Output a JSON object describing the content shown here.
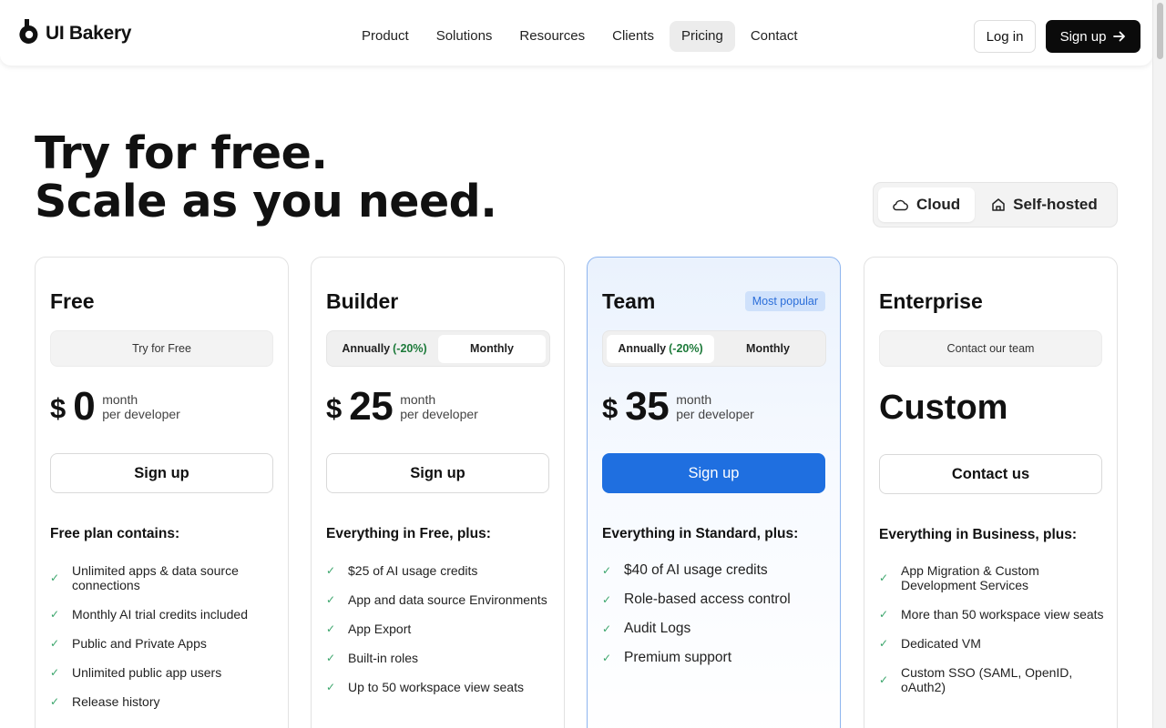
{
  "header": {
    "logo_text": "UI Bakery",
    "nav": [
      {
        "label": "Product",
        "active": false
      },
      {
        "label": "Solutions",
        "active": false
      },
      {
        "label": "Resources",
        "active": false
      },
      {
        "label": "Clients",
        "active": false
      },
      {
        "label": "Pricing",
        "active": true
      },
      {
        "label": "Contact",
        "active": false
      }
    ],
    "login_label": "Log in",
    "signup_label": "Sign up"
  },
  "hero": {
    "title_line1": "Try for free.",
    "title_line2": "Scale as you need."
  },
  "deployment_toggle": {
    "cloud_label": "Cloud",
    "self_hosted_label": "Self-hosted",
    "selected": "Cloud"
  },
  "plans": [
    {
      "name": "Free",
      "bar_label": "Try for Free",
      "currency": "$",
      "price": "0",
      "period": "month",
      "unit": "per developer",
      "cta": "Sign up",
      "contains_title": "Free plan contains:",
      "features": [
        "Unlimited apps & data source connections",
        "Monthly AI trial credits included",
        "Public and Private Apps",
        "Unlimited public app users",
        "Release history"
      ]
    },
    {
      "name": "Builder",
      "billing": {
        "annually": "Annually",
        "discount": "(-20%)",
        "monthly": "Monthly",
        "selected": "Monthly"
      },
      "currency": "$",
      "price": "25",
      "period": "month",
      "unit": "per developer",
      "cta": "Sign up",
      "contains_title": "Everything in Free, plus:",
      "features": [
        "$25 of AI usage credits",
        "App and data source Environments",
        "App Export",
        "Built-in roles",
        "Up to 50 workspace view seats"
      ]
    },
    {
      "name": "Team",
      "badge": "Most popular",
      "billing": {
        "annually": "Annually",
        "discount": "(-20%)",
        "monthly": "Monthly",
        "selected": "Annually"
      },
      "currency": "$",
      "price": "35",
      "period": "month",
      "unit": "per developer",
      "cta": "Sign up",
      "contains_title": "Everything in Standard, plus:",
      "features": [
        "$40 of AI usage credits",
        "Role-based access control",
        "Audit Logs",
        "Premium support"
      ]
    },
    {
      "name": "Enterprise",
      "bar_label": "Contact our team",
      "price_text": "Custom",
      "cta": "Contact us",
      "contains_title": "Everything in Business, plus:",
      "features": [
        "App Migration & Custom Development Services",
        "More than 50 workspace view seats",
        "Dedicated VM",
        "Custom SSO (SAML, OpenID, oAuth2)"
      ]
    }
  ],
  "colors": {
    "accent": "#1f6fe0",
    "badge_bg": "#cfe1fb",
    "discount_green": "#1d7a3a",
    "check_green": "#3aa56b"
  }
}
